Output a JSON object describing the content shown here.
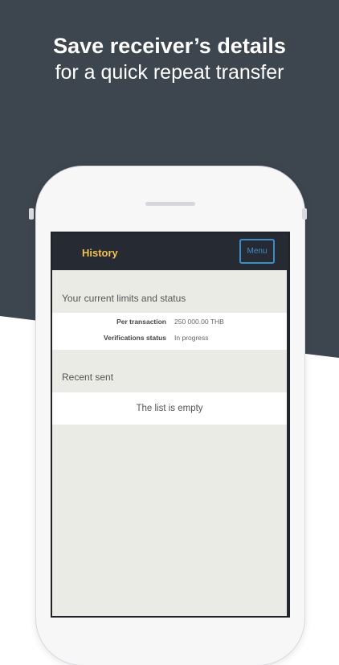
{
  "promo": {
    "headline": "Save receiver’s details",
    "subheadline": "for a quick repeat transfer"
  },
  "colors": {
    "background_dark": "#3d454f",
    "header": "#262a33",
    "title_accent": "#f2c14e",
    "menu_accent": "#3b8fc4",
    "content_bg": "#ebebe6"
  },
  "app": {
    "title": "History",
    "menu_label": "Menu"
  },
  "limits": {
    "section_title": "Your current limits and status",
    "rows": [
      {
        "label": "Per transaction",
        "value": "250 000.00 THB"
      },
      {
        "label": "Verifications status",
        "value": "In progress"
      }
    ]
  },
  "recent": {
    "section_title": "Recent sent",
    "empty_text": "The list is empty"
  }
}
